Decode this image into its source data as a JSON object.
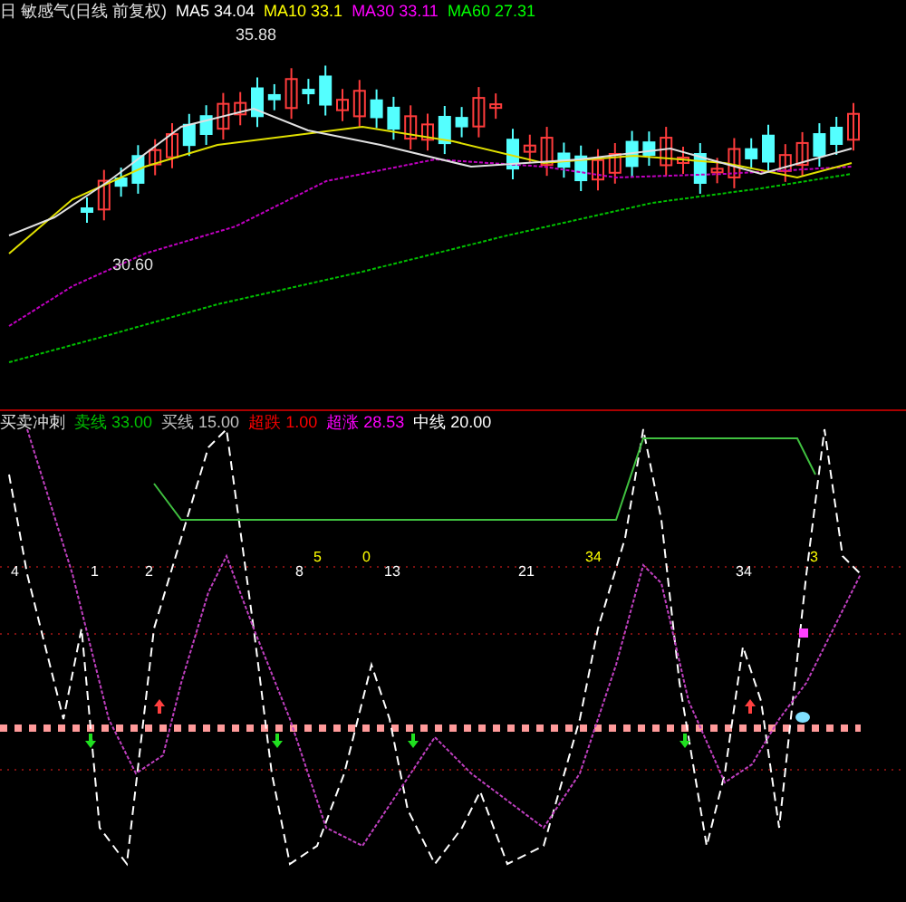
{
  "main_panel": {
    "title": "日 敏感气(日线 前复权)",
    "indicators": [
      {
        "label": "MA5",
        "value": "34.04",
        "color": "#ffffff"
      },
      {
        "label": "MA10",
        "value": "33.1",
        "color": "#ffff00"
      },
      {
        "label": "MA30",
        "value": "33.11",
        "color": "#ff00ff"
      },
      {
        "label": "MA60",
        "value": "27.31",
        "color": "#00ff00"
      }
    ],
    "price_labels": [
      "35.88",
      "30.60"
    ]
  },
  "sub_panel": {
    "title": "买卖冲刺",
    "indicators": [
      {
        "label": "卖线",
        "value": "33.00",
        "color": "#00c000"
      },
      {
        "label": "买线",
        "value": "15.00",
        "color": "#c0c0c0"
      },
      {
        "label": "超跌",
        "value": "1.00",
        "color": "#ff0000"
      },
      {
        "label": "超涨",
        "value": "28.53",
        "color": "#ff00ff"
      },
      {
        "label": "中线",
        "value": "20.00",
        "color": "#ffffff"
      }
    ],
    "counts": [
      {
        "text": "4",
        "color": "#ffffff"
      },
      {
        "text": "1",
        "color": "#ffffff"
      },
      {
        "text": "2",
        "color": "#ffffff"
      },
      {
        "text": "5",
        "color": "#ffff00"
      },
      {
        "text": "0",
        "color": "#ffff00"
      },
      {
        "text": "8",
        "color": "#ffffff"
      },
      {
        "text": "13",
        "color": "#ffffff"
      },
      {
        "text": "21",
        "color": "#ffffff"
      },
      {
        "text": "34",
        "color": "#ffff00"
      },
      {
        "text": "34",
        "color": "#ffffff"
      },
      {
        "text": "3",
        "color": "#ffff00"
      }
    ]
  }
}
